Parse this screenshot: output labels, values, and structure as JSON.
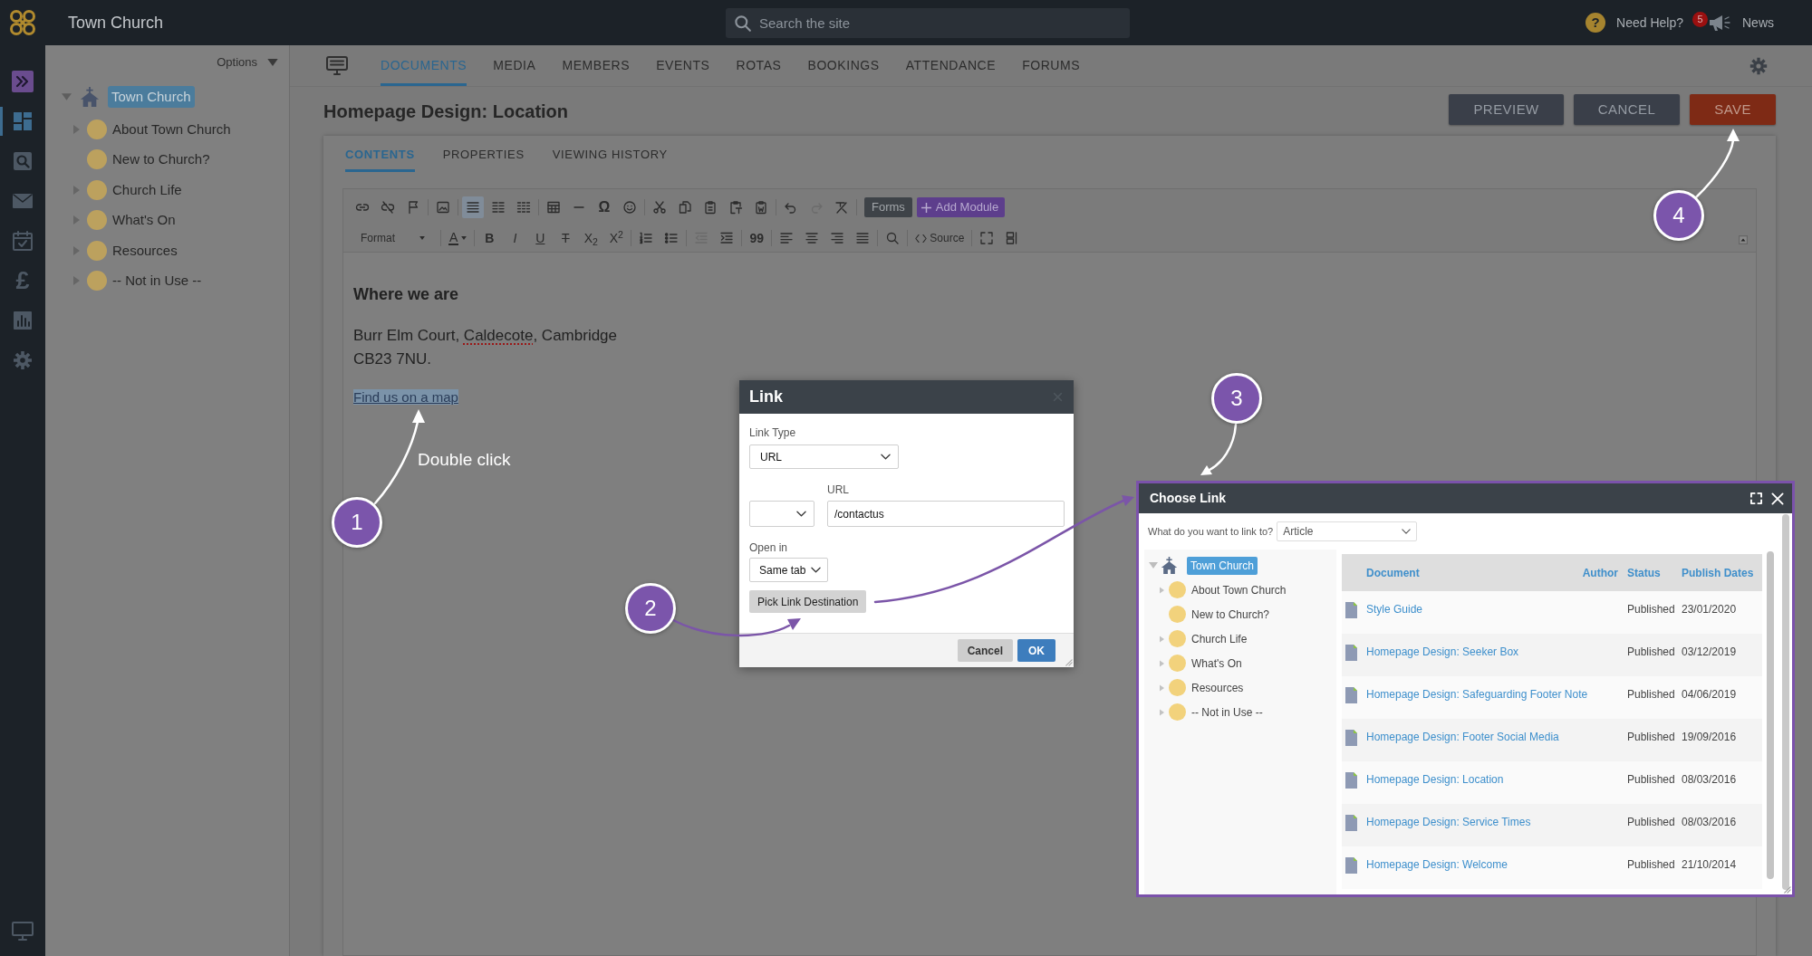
{
  "topbar": {
    "site_name": "Town Church",
    "search": {
      "placeholder": "Search the site"
    },
    "help": {
      "glyph": "?",
      "label": "Need Help?"
    },
    "news": {
      "count": "5",
      "label": "News"
    }
  },
  "rail": {
    "items": [
      {
        "kind": "icon",
        "selected": true
      },
      {
        "kind": "icon",
        "selected": false
      },
      {
        "kind": "icon",
        "selected": false
      },
      {
        "kind": "icon",
        "selected": false
      },
      {
        "kind": "glyph",
        "label": "£",
        "selected": false
      },
      {
        "kind": "icon",
        "selected": false
      },
      {
        "kind": "icon",
        "selected": false
      }
    ]
  },
  "sidebar": {
    "options": "Options",
    "tree": [
      {
        "label": "Town Church",
        "selected": true,
        "expanded": true,
        "children": [
          {
            "label": "About Town Church",
            "selected": false,
            "expandable": true
          },
          {
            "label": "New to Church?",
            "selected": false,
            "expandable": false
          },
          {
            "label": "Church Life",
            "selected": false,
            "expandable": true
          },
          {
            "label": "What's On",
            "selected": false,
            "expandable": true
          },
          {
            "label": "Resources",
            "selected": false,
            "expandable": true
          },
          {
            "label": "-- Not in Use --",
            "selected": false,
            "expandable": true
          }
        ]
      }
    ]
  },
  "tabs": [
    {
      "label": "DOCUMENTS",
      "selected": true
    },
    {
      "label": "MEDIA",
      "selected": false
    },
    {
      "label": "MEMBERS",
      "selected": false
    },
    {
      "label": "EVENTS",
      "selected": false
    },
    {
      "label": "ROTAS",
      "selected": false
    },
    {
      "label": "BOOKINGS",
      "selected": false
    },
    {
      "label": "ATTENDANCE",
      "selected": false
    },
    {
      "label": "FORUMS",
      "selected": false
    }
  ],
  "page": {
    "title": "Homepage Design: Location",
    "buttons": [
      {
        "label": "PREVIEW",
        "kind": "secondary"
      },
      {
        "label": "CANCEL",
        "kind": "secondary"
      },
      {
        "label": "SAVE",
        "kind": "primary"
      }
    ],
    "subtabs": [
      {
        "label": "CONTENTS",
        "selected": true
      },
      {
        "label": "PROPERTIES",
        "selected": false
      },
      {
        "label": "VIEWING HISTORY",
        "selected": false
      }
    ]
  },
  "editor": {
    "toolbar": {
      "rows": [
        {
          "groups": [
            [
              {
                "kind": "icon",
                "on": false,
                "disabled": false
              },
              {
                "kind": "icon",
                "on": false,
                "disabled": false
              },
              {
                "kind": "icon",
                "on": false,
                "disabled": false
              }
            ],
            [
              {
                "kind": "icon",
                "on": false,
                "disabled": false
              }
            ],
            [
              {
                "kind": "icon",
                "on": true,
                "disabled": false
              },
              {
                "kind": "icon",
                "on": false,
                "disabled": false
              },
              {
                "kind": "icon",
                "on": false,
                "disabled": false
              }
            ],
            [
              {
                "kind": "icon",
                "on": false,
                "disabled": false
              },
              {
                "kind": "icon",
                "on": false,
                "disabled": false
              },
              {
                "kind": "glyph",
                "label": "Ω"
              },
              {
                "kind": "icon",
                "on": false,
                "disabled": false
              }
            ],
            [
              {
                "kind": "icon",
                "on": false,
                "disabled": false
              },
              {
                "kind": "icon",
                "on": false,
                "disabled": false
              },
              {
                "kind": "icon",
                "on": false,
                "disabled": false
              },
              {
                "kind": "icon",
                "on": false,
                "disabled": false
              },
              {
                "kind": "icon",
                "on": false,
                "disabled": false
              }
            ],
            [
              {
                "kind": "icon",
                "on": false,
                "disabled": false
              },
              {
                "kind": "icon",
                "on": false,
                "disabled": true
              },
              {
                "kind": "icon",
                "on": false,
                "disabled": false
              }
            ],
            [
              {
                "kind": "button",
                "label": "Forms"
              },
              {
                "kind": "accent_button",
                "label": "Add Module"
              }
            ]
          ]
        },
        {
          "groups": [
            [
              {
                "kind": "dropdown",
                "label": "Format"
              }
            ],
            [
              {
                "kind": "color",
                "label": "A"
              }
            ],
            [
              {
                "kind": "glyph",
                "label": "B"
              },
              {
                "kind": "glyph",
                "label": "I"
              },
              {
                "kind": "glyph",
                "label": "U"
              },
              {
                "kind": "glyph",
                "label": "T"
              },
              {
                "kind": "glyph",
                "label": "X$_{2}$"
              },
              {
                "kind": "glyph",
                "label": "X$^{2}$"
              }
            ],
            [
              {
                "kind": "icon",
                "on": false,
                "disabled": false
              },
              {
                "kind": "icon",
                "on": false,
                "disabled": false
              }
            ],
            [
              {
                "kind": "icon",
                "on": false,
                "disabled": true
              },
              {
                "kind": "icon",
                "on": false,
                "disabled": false
              }
            ],
            [
              {
                "kind": "glyph",
                "label": "99"
              }
            ],
            [
              {
                "kind": "icon",
                "on": false,
                "disabled": false
              },
              {
                "kind": "icon",
                "on": false,
                "disabled": false
              },
              {
                "kind": "icon",
                "on": false,
                "disabled": false
              },
              {
                "kind": "icon",
                "on": false,
                "disabled": false
              }
            ],
            [
              {
                "kind": "icon",
                "on": false,
                "disabled": false
              }
            ],
            [
              {
                "kind": "source",
                "label": "Source"
              }
            ],
            [
              {
                "kind": "icon",
                "on": false,
                "disabled": false
              },
              {
                "kind": "icon",
                "on": false,
                "disabled": false
              }
            ]
          ]
        }
      ]
    },
    "content": {
      "heading": "Where we are",
      "address": [
        {
          "segments": [
            {
              "text": "Burr Elm Court, ",
              "misspelled": false
            },
            {
              "text": "Caldecote",
              "misspelled": true
            },
            {
              "text": ", Cambridge",
              "misspelled": false
            }
          ]
        },
        {
          "segments": [
            {
              "text": "CB23 7NU.",
              "misspelled": false
            }
          ]
        }
      ],
      "link": {
        "text": "Find us on a map",
        "selected": true
      }
    }
  },
  "link_dialog": {
    "title": "Link",
    "link_type": {
      "label": "Link Type",
      "value": "URL"
    },
    "url": {
      "label": "URL",
      "value": "/contactus"
    },
    "open_in": {
      "label": "Open in",
      "value": "Same tab"
    },
    "pick_button": "Pick Link Destination",
    "buttons": [
      {
        "label": "Cancel",
        "kind": "secondary"
      },
      {
        "label": "OK",
        "kind": "primary"
      }
    ]
  },
  "choose_link_dialog": {
    "title": "Choose Link",
    "prompt": "What do you want to link to?",
    "link_kind": "Article",
    "tree": [
      {
        "label": "Town Church",
        "selected": true,
        "expanded": true,
        "children": [
          {
            "label": "About Town Church",
            "selected": false,
            "expandable": true
          },
          {
            "label": "New to Church?",
            "selected": false,
            "expandable": false
          },
          {
            "label": "Church Life",
            "selected": false,
            "expandable": true
          },
          {
            "label": "What's On",
            "selected": false,
            "expandable": true
          },
          {
            "label": "Resources",
            "selected": false,
            "expandable": true
          },
          {
            "label": "-- Not in Use --",
            "selected": false,
            "expandable": true
          }
        ]
      }
    ],
    "table": {
      "columns": [
        "Document",
        "Author",
        "Status",
        "Publish Dates"
      ],
      "rows": [
        {
          "document": "Style Guide",
          "status": "Published",
          "publish_dates": "23/01/2020"
        },
        {
          "document": "Homepage Design: Seeker Box",
          "status": "Published",
          "publish_dates": "03/12/2019"
        },
        {
          "document": "Homepage Design: Safeguarding Footer Note",
          "status": "Published",
          "publish_dates": "04/06/2019"
        },
        {
          "document": "Homepage Design: Footer Social Media",
          "status": "Published",
          "publish_dates": "19/09/2016"
        },
        {
          "document": "Homepage Design: Location",
          "status": "Published",
          "publish_dates": "08/03/2016"
        },
        {
          "document": "Homepage Design: Service Times",
          "status": "Published",
          "publish_dates": "08/03/2016"
        },
        {
          "document": "Homepage Design: Welcome",
          "status": "Published",
          "publish_dates": "21/10/2014"
        }
      ]
    }
  },
  "annotations": [
    {
      "number": "1",
      "caption": "Double click"
    },
    {
      "number": "2"
    },
    {
      "number": "3"
    },
    {
      "number": "4"
    }
  ]
}
